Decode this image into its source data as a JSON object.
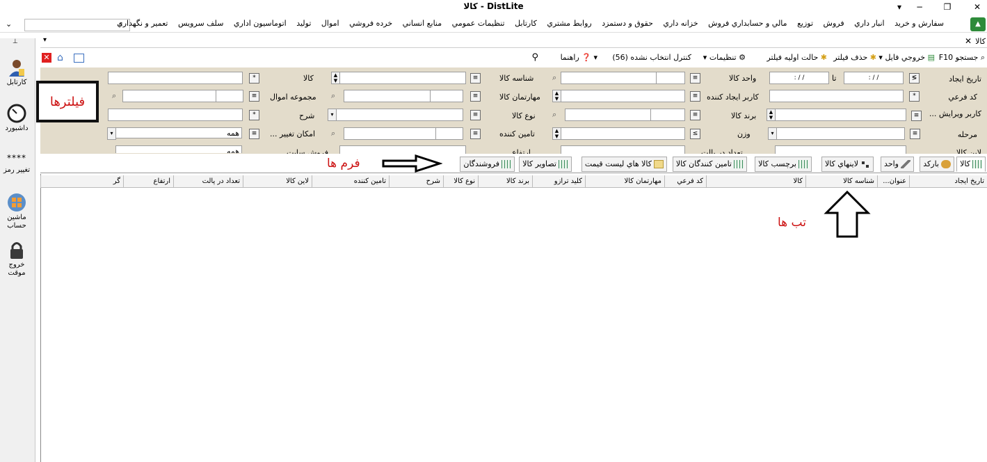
{
  "window": {
    "title": "كالا - DistLite",
    "controls": [
      "▾",
      "−",
      "❐",
      "✕"
    ]
  },
  "menubar": {
    "items": [
      "سفارش و خريد",
      "انبار داري",
      "فروش",
      "توزيع",
      "مالي و حسابداري فروش",
      "خزانه داري",
      "حقوق و دستمزد",
      "روابط مشتري",
      "كارتابل",
      "تنظيمات عمومي",
      "منابع انساني",
      "خرده فروشي",
      "اموال",
      "توليد",
      "اتوماسيون اداري",
      "سلف سرويس",
      "تعمير و نگهداري"
    ]
  },
  "doc_tab": {
    "label": "كالا"
  },
  "sidebar": {
    "items": [
      {
        "label": "كارتابل"
      },
      {
        "label": "داشبورد"
      },
      {
        "label": "تغيير رمز"
      },
      {
        "label": "ماشين حساب"
      },
      {
        "label": "خروج موقت"
      }
    ]
  },
  "toolbar": {
    "search": "جستجو F10",
    "export": "خروجي فايل",
    "clear_filter": "حذف فيلتر",
    "initial_filter": "حالت اوليه فيلتر",
    "settings": "تنظيمات",
    "unselected": "كنترل انتخاب نشده (56)",
    "help": "راهنما"
  },
  "filters": {
    "labels": {
      "create_date": "تاريخ ايجاد",
      "to": "تا",
      "unit": "واحد كالا",
      "item_id": "شناسه كالا",
      "item": "كالا",
      "sub_code": "كد فرعي",
      "creator": "كاربر ايجاد كننده",
      "item_skill": "مهارتمان كالا",
      "asset_group": "مجموعه اموال",
      "editor": "كاربر ويرايش ...",
      "brand": "برند كالا",
      "item_type": "نوع كالا",
      "desc": "شرح",
      "stage": "مرحله",
      "weight": "وزن",
      "supplier": "تامين كننده",
      "change_option": "امكان تغيير ...",
      "item_line": "لاين كالا",
      "pallet_count": "تعداد در پالت",
      "height": "ارتفاع",
      "sale_site": "فروش سايت"
    },
    "date_from": "  :   / /  ",
    "date_to": "  :   / /  ",
    "all_value": "همه",
    "all_value2": "همه"
  },
  "annotations": {
    "filters": "فيلترها",
    "forms": "فرم ها",
    "tabs": "تب ها"
  },
  "tabs": [
    {
      "label": "كالا"
    },
    {
      "label": "باركد"
    },
    {
      "label": "واحد"
    },
    {
      "label": "لاينهاي كالا"
    },
    {
      "label": "برچسب كالا"
    },
    {
      "label": "تامين كنندگان كالا"
    },
    {
      "label": "كالا هاي ليست قيمت"
    },
    {
      "label": "تصاوير كالا"
    },
    {
      "label": "فروشندگان"
    }
  ],
  "grid": {
    "columns": [
      "تاريخ ايجاد",
      "عنوان...",
      "شناسه كالا",
      "كالا",
      "كد فرعي",
      "مهارتمان كالا",
      "كليد ترازو",
      "برند كالا",
      "نوع كالا",
      "شرح",
      "تامين كننده",
      "لاين كالا",
      "تعداد در پالت",
      "ارتفاع",
      "گر"
    ]
  }
}
